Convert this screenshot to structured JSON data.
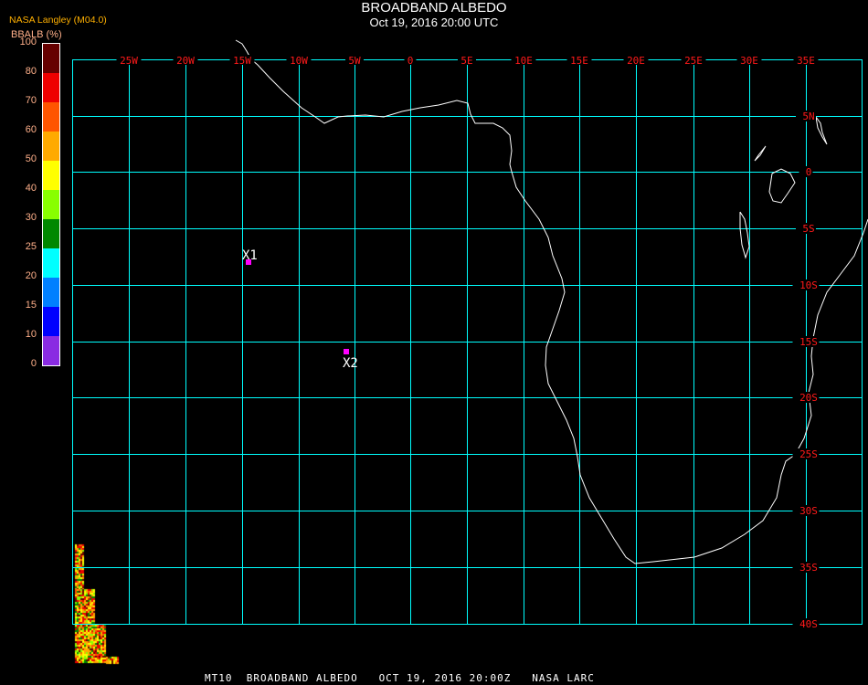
{
  "header": {
    "title": "BROADBAND ALBEDO",
    "subtitle": "Oct 19, 2016 20:00 UTC",
    "organization": "NASA Langley (M04.0)"
  },
  "colorbar": {
    "label": "BBALB (%)",
    "ticks": [
      "100",
      "80",
      "70",
      "60",
      "50",
      "40",
      "30",
      "25",
      "20",
      "15",
      "10",
      "0"
    ],
    "colors": [
      "#660000",
      "#ee0000",
      "#ff5500",
      "#ffaa00",
      "#ffff00",
      "#88ff00",
      "#008800",
      "#00ffff",
      "#0080ff",
      "#0000ff",
      "#8a2be2"
    ]
  },
  "map": {
    "grid_color": "#00ffff",
    "label_color": "#ff1a1a",
    "longitude_labels": [
      "25W",
      "20W",
      "15W",
      "10W",
      "5W",
      "0",
      "5E",
      "10E",
      "15E",
      "20E",
      "25E",
      "30E",
      "35E"
    ],
    "latitude_labels": [
      "5N",
      "0",
      "5S",
      "10S",
      "15S",
      "20S",
      "25S",
      "30S",
      "35S",
      "40S"
    ],
    "markers": [
      {
        "label": "X1",
        "color": "#ff00ff"
      },
      {
        "label": "X2",
        "color": "#ff00ff"
      }
    ]
  },
  "footer": {
    "text": "MT10  BROADBAND ALBEDO   OCT 19, 2016 20:00Z   NASA LARC"
  }
}
